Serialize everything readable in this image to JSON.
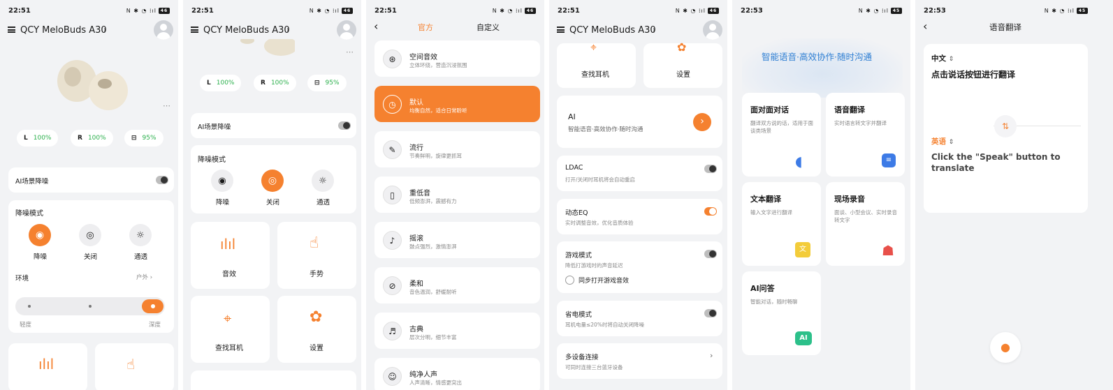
{
  "colors": {
    "accent": "#f5812f",
    "battery_green": "#2bb04c",
    "title_blue": "#2f7fd3"
  },
  "icons": [
    "menu-icon",
    "avatar-icon",
    "chevron-right-icon",
    "more-icon",
    "back-icon",
    "microphone-icon",
    "swap-icon",
    "waveform-icon",
    "hand-icon",
    "location-icon",
    "gear-icon"
  ],
  "screen1": {
    "time": "22:51",
    "device_name": "QCY MeloBuds A30",
    "battery": {
      "left_label": "L",
      "left": "100%",
      "right_label": "R",
      "right": "100%",
      "case": "95%"
    },
    "ai_anc_label": "AI场景降噪",
    "anc_title": "降噪模式",
    "modes": [
      "降噪",
      "关闭",
      "通透"
    ],
    "env_label": "环境",
    "env_value": "户外",
    "slider_labels": [
      "轻度",
      "深度"
    ]
  },
  "screen2": {
    "time": "22:51",
    "device_name": "QCY MeloBuds A30",
    "battery": {
      "left_label": "L",
      "left": "100%",
      "right_label": "R",
      "right": "100%",
      "case": "95%"
    },
    "ai_anc_label": "AI场景降噪",
    "anc_title": "降噪模式",
    "modes": [
      "降噪",
      "关闭",
      "通透"
    ],
    "tiles": [
      "音效",
      "手势",
      "查找耳机",
      "设置"
    ]
  },
  "screen3": {
    "time": "22:51",
    "tabs": [
      "官方",
      "自定义"
    ],
    "presets": [
      {
        "title": "空间音效",
        "sub": "立体环绕，营造沉浸氛围"
      },
      {
        "title": "默认",
        "sub": "均衡自然，适合日常聆听"
      },
      {
        "title": "流行",
        "sub": "节奏鲜明，旋律更抓耳"
      },
      {
        "title": "重低音",
        "sub": "低频澎湃，震撼有力"
      },
      {
        "title": "摇滚",
        "sub": "鼓点强烈，激情澎湃"
      },
      {
        "title": "柔和",
        "sub": "音色温润，舒缓耐听"
      },
      {
        "title": "古典",
        "sub": "层次分明，细节丰富"
      },
      {
        "title": "纯净人声",
        "sub": "人声清晰，情感更突出"
      }
    ]
  },
  "screen4": {
    "time": "22:51",
    "device_name": "QCY MeloBuds A30",
    "top_tiles": [
      "查找耳机",
      "设置"
    ],
    "ai": {
      "title": "AI",
      "sub": "智能语音·高效协作·随时沟通"
    },
    "settings": [
      {
        "title": "LDAC",
        "sub": "打开/关闭时耳机将会自动重启"
      },
      {
        "title": "动态EQ",
        "sub": "实时调整音效，优化音质体验"
      },
      {
        "title": "游戏模式",
        "sub": "降低打游戏时的声音延迟"
      },
      {
        "title": "省电模式",
        "sub": "耳机电量≤20%时将自动关闭降噪"
      },
      {
        "title": "多设备连接",
        "sub": "可同时连接三台蓝牙设备"
      }
    ],
    "sync_game_sound": "同步打开游戏音效"
  },
  "screen5": {
    "time": "22:53",
    "headline": "智能语音·高效协作·随时沟通",
    "features": [
      {
        "title": "面对面对话",
        "sub": "翻译双方说的话，适用于面谈类场景"
      },
      {
        "title": "语音翻译",
        "sub": "实时语言转文字并翻译"
      },
      {
        "title": "文本翻译",
        "sub": "输入文字进行翻译"
      },
      {
        "title": "现场录音",
        "sub": "面谈、小型会议、实时录音转文字"
      },
      {
        "title": "AI问答",
        "sub": "智能对话，随时畅聊"
      }
    ]
  },
  "screen6": {
    "time": "22:53",
    "title": "语音翻译",
    "source_lang": "中文",
    "source_hint": "点击说话按钮进行翻译",
    "target_lang": "英语",
    "target_hint": "Click the \"Speak\" button to translate"
  }
}
